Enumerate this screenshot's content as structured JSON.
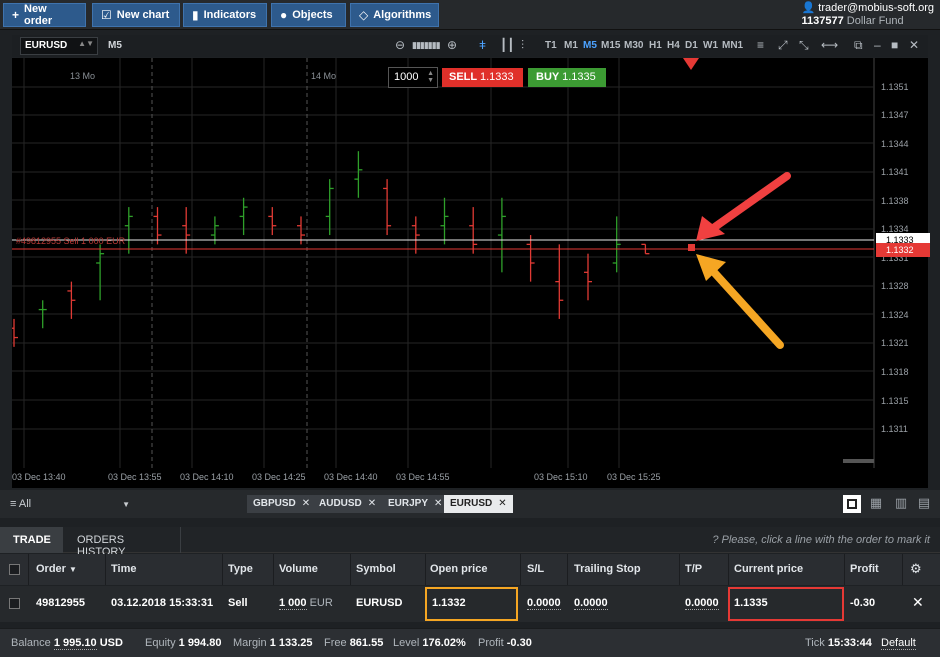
{
  "toolbar": {
    "new_order": "New order",
    "new_chart": "New chart",
    "indicators": "Indicators",
    "objects": "Objects",
    "algorithms": "Algorithms"
  },
  "account": {
    "user": "trader@mobius-soft.org",
    "id": "1137577",
    "fund": "Dollar Fund"
  },
  "chart": {
    "symbol": "EURUSD",
    "timeframe": "M5",
    "timeframes": [
      "T1",
      "M1",
      "M5",
      "M15",
      "M30",
      "H1",
      "H4",
      "D1",
      "W1",
      "MN1"
    ],
    "active_timeframe": "M5",
    "quantity": "1000",
    "sell_label": "SELL",
    "sell_price": "1.1333",
    "buy_label": "BUY",
    "buy_price": "1.1335",
    "day_labels": [
      "13 Mo",
      "14 Mo"
    ],
    "price_ticks": [
      "1.1351",
      "1.1347",
      "1.1344",
      "1.1341",
      "1.1338",
      "1.1334",
      "1.1331",
      "1.1328",
      "1.1324",
      "1.1321",
      "1.1318",
      "1.1315",
      "1.1311"
    ],
    "time_ticks": [
      "03 Dec 13:40",
      "03 Dec 13:55",
      "03 Dec 14:10",
      "03 Dec 14:25",
      "03 Dec 14:40",
      "03 Dec 14:55",
      "03 Dec 15:10",
      "03 Dec 15:25"
    ],
    "current_price": "1.1333",
    "order_price": "1.1332",
    "order_line_label": "#49812955 Sell 1 000 EUR"
  },
  "chart_data": {
    "type": "ohlc",
    "title": "",
    "xlabel": "",
    "ylabel": "",
    "x": [
      "13:40",
      "13:45",
      "13:50",
      "13:55",
      "14:00",
      "14:05",
      "14:10",
      "14:15",
      "14:20",
      "14:25",
      "14:30",
      "14:35",
      "14:40",
      "14:45",
      "14:50",
      "14:55",
      "15:00",
      "15:05",
      "15:10",
      "15:15",
      "15:20",
      "15:25",
      "15:30"
    ],
    "ohlc": [
      [
        1.1324,
        1.1325,
        1.1322,
        1.1323
      ],
      [
        1.1326,
        1.1327,
        1.1324,
        1.1326
      ],
      [
        1.1328,
        1.1329,
        1.1325,
        1.1327
      ],
      [
        1.1331,
        1.1333,
        1.1327,
        1.1332
      ],
      [
        1.1335,
        1.1337,
        1.1332,
        1.1336
      ],
      [
        1.1336,
        1.1337,
        1.1333,
        1.1334
      ],
      [
        1.1335,
        1.1337,
        1.1332,
        1.1334
      ],
      [
        1.1334,
        1.1336,
        1.1333,
        1.1335
      ],
      [
        1.1336,
        1.1338,
        1.1334,
        1.1337
      ],
      [
        1.1336,
        1.1337,
        1.1334,
        1.1335
      ],
      [
        1.1335,
        1.1336,
        1.1333,
        1.1334
      ],
      [
        1.1336,
        1.134,
        1.1334,
        1.1339
      ],
      [
        1.134,
        1.1343,
        1.1338,
        1.1341
      ],
      [
        1.1339,
        1.134,
        1.1334,
        1.1335
      ],
      [
        1.1335,
        1.1336,
        1.1332,
        1.1334
      ],
      [
        1.1335,
        1.1338,
        1.1333,
        1.1336
      ],
      [
        1.1335,
        1.1337,
        1.1332,
        1.1333
      ],
      [
        1.1334,
        1.1338,
        1.133,
        1.1336
      ],
      [
        1.1333,
        1.1334,
        1.1329,
        1.1331
      ],
      [
        1.1329,
        1.1333,
        1.1325,
        1.1327
      ],
      [
        1.133,
        1.1332,
        1.1327,
        1.1329
      ],
      [
        1.1331,
        1.1336,
        1.133,
        1.1333
      ],
      [
        1.1333,
        1.1333,
        1.1332,
        1.1332
      ]
    ],
    "ylim": [
      1.1309,
      1.1353
    ]
  },
  "symbol_tabs": {
    "filter": "All",
    "tabs": [
      "GBPUSD",
      "AUDUSD",
      "EURJPY",
      "EURUSD"
    ],
    "active": "EURUSD"
  },
  "trade_panel": {
    "tab_trade": "TRADE",
    "tab_history": "ORDERS HISTORY",
    "hint": "Please, click a line with the order to mark it",
    "columns": [
      "Order",
      "Time",
      "Type",
      "Volume",
      "Symbol",
      "Open price",
      "S/L",
      "Trailing Stop",
      "T/P",
      "Current price",
      "Profit"
    ],
    "row": {
      "order": "49812955",
      "time": "03.12.2018 15:33:31",
      "type": "Sell",
      "volume": "1 000",
      "volume_unit": "EUR",
      "symbol": "EURUSD",
      "open_price": "1.1332",
      "sl": "0.0000",
      "trailing_stop": "0.0000",
      "tp": "0.0000",
      "current_price": "1.1335",
      "profit": "-0.30"
    }
  },
  "status": {
    "balance_label": "Balance",
    "balance": "1 995.10",
    "balance_currency": "USD",
    "equity_label": "Equity",
    "equity": "1 994.80",
    "margin_label": "Margin",
    "margin": "1 133.25",
    "free_label": "Free",
    "free": "861.55",
    "level_label": "Level",
    "level": "176.02%",
    "profit_label": "Profit",
    "profit": "-0.30",
    "tick_label": "Tick",
    "tick": "15:33:44",
    "default_label": "Default"
  },
  "colors": {
    "sell": "#e0302a",
    "buy": "#3c9b33",
    "bull": "#2fa02a",
    "bear": "#e03a34",
    "arrow_red": "#f04040",
    "arrow_orange": "#f5a623"
  }
}
